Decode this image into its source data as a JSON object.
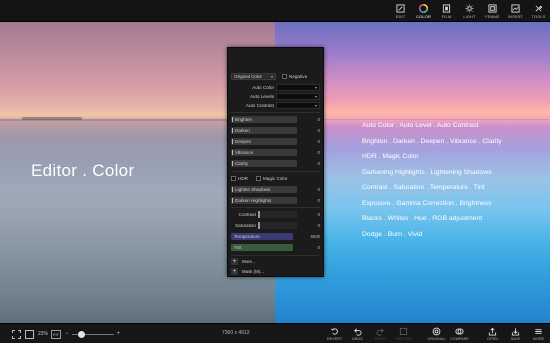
{
  "toolbar": {
    "tools": [
      {
        "label": "EDIT",
        "icon": "edit-icon"
      },
      {
        "label": "COLOR",
        "icon": "color-wheel-icon",
        "active": true
      },
      {
        "label": "FILM",
        "icon": "film-icon"
      },
      {
        "label": "LIGHT",
        "icon": "light-icon"
      },
      {
        "label": "FRAME",
        "icon": "frame-icon"
      },
      {
        "label": "INSERT",
        "icon": "insert-icon"
      },
      {
        "label": "TOOLS",
        "icon": "tools-icon"
      }
    ]
  },
  "canvas": {
    "headline": "Editor . Color",
    "features": [
      "Auto Color . Auto Level . Auto Contrast",
      "Brighten . Darken . Deepen . Vibrance . Clarity",
      "HDR . Magic Color",
      "Darkening Highlights . Lightening Shadows",
      "Contrast . Saturation . Temperature . Tint",
      "Exposure . Gamma Correction . Brightness",
      "Blacks . Whites . Hue . RGB adjustment",
      "Dodge . Burn . Vivid"
    ]
  },
  "panel": {
    "mode": "Original Color",
    "negative_label": "Negative",
    "auto": [
      {
        "label": "Auto Color"
      },
      {
        "label": "Auto Levels"
      },
      {
        "label": "Auto Contrast"
      }
    ],
    "sliders": [
      {
        "label": "Brighten",
        "value": "0"
      },
      {
        "label": "Darken",
        "value": "0"
      },
      {
        "label": "Deepen",
        "value": "0"
      },
      {
        "label": "Vibrance",
        "value": "0"
      },
      {
        "label": "Clarity",
        "value": "0"
      }
    ],
    "hdr_label": "HDR",
    "magic_label": "Magic Color",
    "shadow_sliders": [
      {
        "label": "Lighten Shadows",
        "value": "0"
      },
      {
        "label": "Darken Highlights",
        "value": "0"
      }
    ],
    "tone_sliders": [
      {
        "label": "Contrast",
        "value": "0"
      },
      {
        "label": "Saturation",
        "value": "0"
      }
    ],
    "temperature": {
      "label": "Temperature",
      "value": "6500"
    },
    "tint": {
      "label": "Tint",
      "value": "0"
    },
    "more_label": "More...",
    "mask_label": "Mask (M)..."
  },
  "bottombar": {
    "zoom": "22%",
    "fit": "FIT",
    "dimensions": "7360 x 4912",
    "actions": [
      {
        "label": "REVERT",
        "icon": "revert-icon"
      },
      {
        "label": "UNDO",
        "icon": "undo-icon"
      },
      {
        "label": "REDO",
        "icon": "redo-icon",
        "disabled": true
      },
      {
        "label": "HISTORY",
        "icon": "history-icon",
        "disabled": true
      },
      {
        "label": "ORIGINAL",
        "icon": "original-icon"
      },
      {
        "label": "COMPARE",
        "icon": "compare-icon"
      },
      {
        "label": "OPEN",
        "icon": "open-icon"
      },
      {
        "label": "SAVE",
        "icon": "save-icon"
      },
      {
        "label": "MORE",
        "icon": "more-icon"
      }
    ]
  },
  "colors": {
    "accent_active": "#ff5a5a",
    "temperature_bar": "#3c3a72",
    "tint_bar": "#3b5a3b"
  }
}
